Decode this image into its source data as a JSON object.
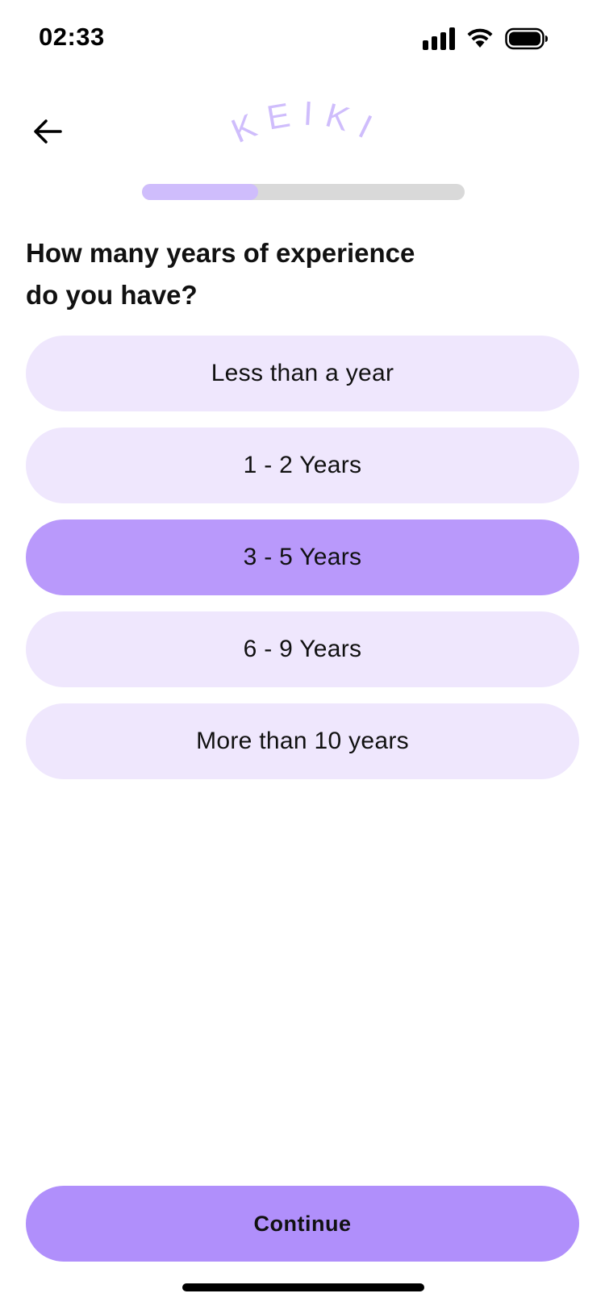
{
  "status_bar": {
    "time": "02:33",
    "icons": [
      "cellular-signal-icon",
      "wifi-icon",
      "battery-icon"
    ]
  },
  "header": {
    "back_icon": "arrow-left-icon",
    "logo_text": "KEIKI",
    "logo_color": "#cfbdfc"
  },
  "progress": {
    "fraction": 0.36,
    "fill_color": "#cfbdfc",
    "track_color": "#d9d9d9"
  },
  "question": {
    "line1": "How many years of experience",
    "line2": "do you have?"
  },
  "options": [
    {
      "label": "Less than a year",
      "selected": false
    },
    {
      "label": "1 - 2 Years",
      "selected": false
    },
    {
      "label": "3 - 5 Years",
      "selected": true
    },
    {
      "label": "6 - 9 Years",
      "selected": false
    },
    {
      "label": "More than 10 years",
      "selected": false
    }
  ],
  "continue_button": {
    "label": "Continue"
  },
  "colors": {
    "option_bg": "#efe7fd",
    "option_selected_bg": "#b999fb",
    "button_bg": "#b08ffb"
  }
}
